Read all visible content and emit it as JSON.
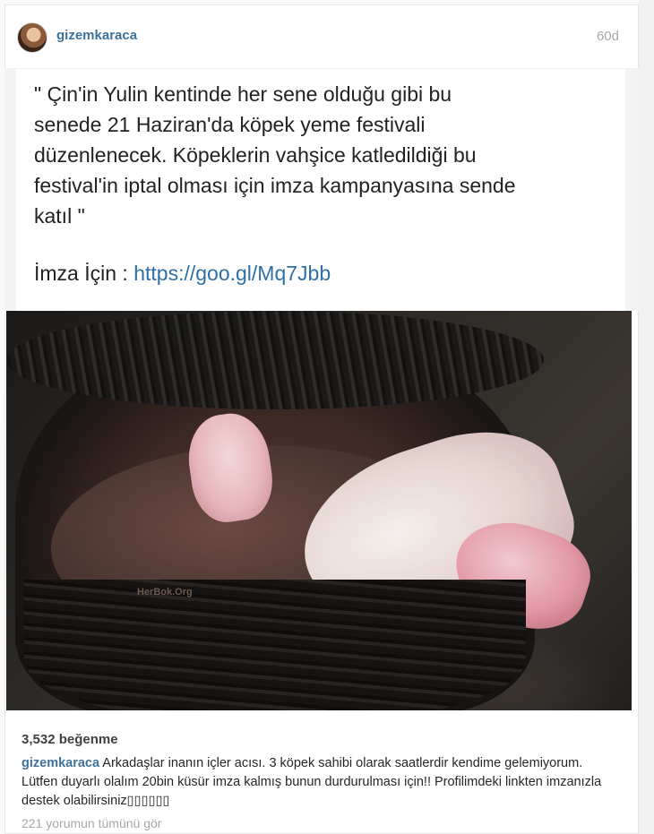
{
  "post": {
    "username": "gizemkaraca",
    "time": "60d"
  },
  "embedded_text": {
    "quote": "\" Çin'in Yulin kentinde her sene olduğu gibi bu\nsenede 21 Haziran'da köpek yeme festivali\ndüzenlenecek. Köpeklerin vahşice katledildiği bu\nfestival'in iptal olması için imza kampanyasına sende\nkatıl \"",
    "imza_label": "İmza İçin : ",
    "imza_link": "https://goo.gl/Mq7Jbb"
  },
  "photo": {
    "watermark": "HerBok.Org"
  },
  "footer": {
    "likes": "3,532 beğenme",
    "caption_user": "gizemkaraca",
    "caption_text": " Arkadaşlar inanın içler acısı. 3 köpek sahibi olarak saatlerdir kendime gelemiyorum. Lütfen duyarlı olalım 20bin küsür imza kalmış bunun durdurulması için!! Profilimdeki linkten imzanızla destek olabilirsiniz▯▯▯▯▯▯",
    "comments_link": "221 yorumun tümünü gör"
  },
  "colors": {
    "username": "#3f729b",
    "link": "#2f6fa7",
    "muted": "#a5a7aa"
  }
}
